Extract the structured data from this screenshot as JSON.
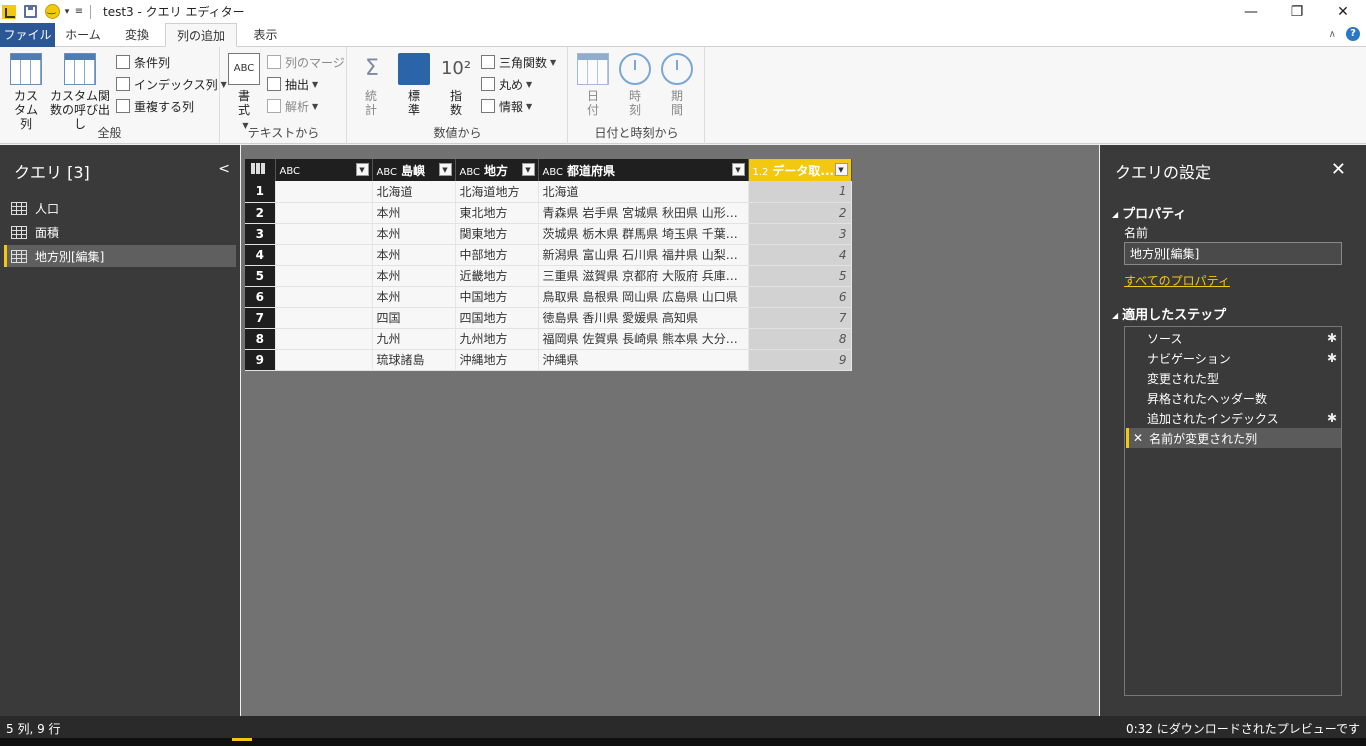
{
  "window": {
    "title": "test3 - クエリ エディター"
  },
  "tabs": [
    {
      "label": "ファイル"
    },
    {
      "label": "ホーム"
    },
    {
      "label": "変換"
    },
    {
      "label": "列の追加"
    },
    {
      "label": "表示"
    }
  ],
  "ribbon": {
    "general": {
      "label": "全般",
      "custom_column": "カスタム列",
      "custom_function": "カスタム関数の呼び出し",
      "conditional_column": "条件列",
      "index_column": "インデックス列",
      "duplicate_column": "重複する列"
    },
    "text": {
      "label": "テキストから",
      "format": "書式",
      "merge_columns": "列のマージ",
      "extract": "抽出",
      "parse": "解析"
    },
    "number": {
      "label": "数値から",
      "statistics": "統計",
      "standard": "標準",
      "scientific": "指数",
      "trigonometry": "三角関数",
      "rounding": "丸め",
      "information": "情報"
    },
    "datetime": {
      "label": "日付と時刻から",
      "date": "日付",
      "time": "時刻",
      "duration": "期間"
    }
  },
  "queries": {
    "title": "クエリ [3]",
    "items": [
      {
        "label": "人口"
      },
      {
        "label": "面積"
      },
      {
        "label": "地方別[編集]"
      }
    ]
  },
  "table": {
    "columns": [
      {
        "type": "ABC",
        "name": ""
      },
      {
        "type": "ABC",
        "name": "島嶼"
      },
      {
        "type": "ABC",
        "name": "地方"
      },
      {
        "type": "ABC",
        "name": "都道府県"
      },
      {
        "type": "1.2",
        "name": "データ取..."
      }
    ],
    "rows": [
      {
        "n": "1",
        "c1": "",
        "c2": "北海道",
        "c3": "北海道地方",
        "c4": "北海道",
        "c5": "1"
      },
      {
        "n": "2",
        "c1": "",
        "c2": "本州",
        "c3": "東北地方",
        "c4": "青森県 岩手県 宮城県 秋田県 山形県 ...",
        "c5": "2"
      },
      {
        "n": "3",
        "c1": "",
        "c2": "本州",
        "c3": "関東地方",
        "c4": "茨城県 栃木県 群馬県 埼玉県 千葉県 ...",
        "c5": "3"
      },
      {
        "n": "4",
        "c1": "",
        "c2": "本州",
        "c3": "中部地方",
        "c4": "新潟県 富山県 石川県 福井県 山梨県 ...",
        "c5": "4"
      },
      {
        "n": "5",
        "c1": "",
        "c2": "本州",
        "c3": "近畿地方",
        "c4": "三重県 滋賀県 京都府 大阪府 兵庫県 ...",
        "c5": "5"
      },
      {
        "n": "6",
        "c1": "",
        "c2": "本州",
        "c3": "中国地方",
        "c4": "鳥取県 島根県 岡山県 広島県 山口県",
        "c5": "6"
      },
      {
        "n": "7",
        "c1": "",
        "c2": "四国",
        "c3": "四国地方",
        "c4": "徳島県 香川県 愛媛県 高知県",
        "c5": "7"
      },
      {
        "n": "8",
        "c1": "",
        "c2": "九州",
        "c3": "九州地方",
        "c4": "福岡県 佐賀県 長崎県 熊本県 大分県 ...",
        "c5": "8"
      },
      {
        "n": "9",
        "c1": "",
        "c2": "琉球諸島",
        "c3": "沖縄地方",
        "c4": "沖縄県",
        "c5": "9"
      }
    ]
  },
  "settings": {
    "title": "クエリの設定",
    "properties_label": "プロパティ",
    "name_label": "名前",
    "name_value": "地方別[編集]",
    "all_properties": "すべてのプロパティ",
    "steps_label": "適用したステップ",
    "steps": [
      {
        "label": "ソース"
      },
      {
        "label": "ナビゲーション"
      },
      {
        "label": "変更された型"
      },
      {
        "label": "昇格されたヘッダー数"
      },
      {
        "label": "追加されたインデックス"
      },
      {
        "label": "名前が変更された列"
      }
    ]
  },
  "status": {
    "left": "5 列, 9 行",
    "right": "0:32 にダウンロードされたプレビューです"
  },
  "colors": {
    "accent": "#f2c811",
    "file_tab": "#2b5797",
    "pane": "#3a3a3a",
    "canvas": "#727272"
  }
}
